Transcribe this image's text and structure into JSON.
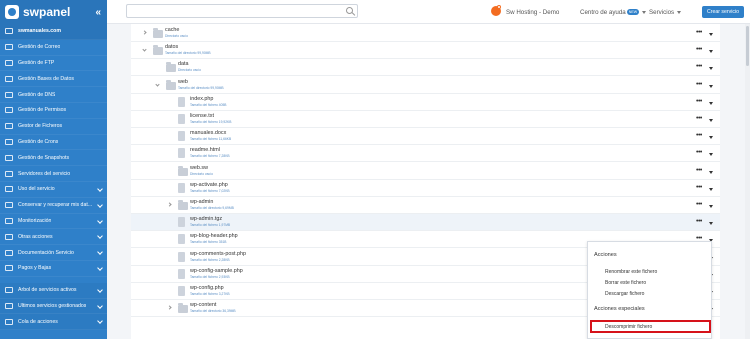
{
  "app": {
    "logo_text": "swpanel",
    "collapse_icon": "double-chevron-left-icon"
  },
  "header": {
    "search": {
      "value": "",
      "placeholder": ""
    },
    "account_name": "Sw Hosting - Demo",
    "help_label": "Centro de ayuda",
    "help_badge": "NEW",
    "services_label": "Servicios",
    "create_button": "Crear servicio",
    "accent": "#2f80c9",
    "avatar_color": "#f36c21"
  },
  "sidebar": {
    "account": "swmanuales.com",
    "items": [
      {
        "label": "Gestión de Correo",
        "icon": "mail-icon",
        "chevron": false
      },
      {
        "label": "Gestión de FTP",
        "icon": "server-icon",
        "chevron": false
      },
      {
        "label": "Gestión Bases de Datos",
        "icon": "database-icon",
        "chevron": false
      },
      {
        "label": "Gestión de DNS",
        "icon": "flag-icon",
        "chevron": false
      },
      {
        "label": "Gestión de Permisos",
        "icon": "permissions-icon",
        "chevron": false
      },
      {
        "label": "Gestor de Ficheros",
        "icon": "files-icon",
        "chevron": false
      },
      {
        "label": "Gestión de Crons",
        "icon": "clock-icon",
        "chevron": false
      },
      {
        "label": "Gestión de Snapshots",
        "icon": "snapshot-icon",
        "chevron": false
      },
      {
        "label": "Servidores del servicio",
        "icon": "servers-icon",
        "chevron": false
      },
      {
        "label": "Uso del servicio",
        "icon": "chart-icon",
        "chevron": true
      },
      {
        "label": "Conservar y recuperar mis dat...",
        "icon": "backup-icon",
        "chevron": true
      },
      {
        "label": "Monitorización",
        "icon": "monitor-icon",
        "chevron": true
      },
      {
        "label": "Otras acciones",
        "icon": "actions-icon",
        "chevron": true
      },
      {
        "label": "Documentación Servicio",
        "icon": "document-icon",
        "chevron": true
      },
      {
        "label": "Pagos y Bajas",
        "icon": "payment-icon",
        "chevron": true
      }
    ],
    "bottom_items": [
      {
        "label": "Árbol de servicios activos",
        "icon": "tree-icon",
        "chevron": true
      },
      {
        "label": "Últimos servicios gestionados",
        "icon": "history-icon",
        "chevron": true
      },
      {
        "label": "Cola de acciones",
        "icon": "queue-icon",
        "chevron": true
      }
    ]
  },
  "files": [
    {
      "name": "cache",
      "meta": "Directorio vacío",
      "type": "folder",
      "expander": "closed",
      "level": 0
    },
    {
      "name": "datos",
      "meta": "Tamaño del directorio 99,90MB",
      "type": "folder",
      "expander": "open",
      "level": 0
    },
    {
      "name": "data",
      "meta": "Directorio vacío",
      "type": "folder",
      "expander": "none",
      "level": 1
    },
    {
      "name": "web",
      "meta": "Tamaño del directorio 99,90MB",
      "type": "folder",
      "expander": "open",
      "level": 1
    },
    {
      "name": "index.php",
      "meta": "Tamaño del fichero 405B",
      "type": "file",
      "expander": "none",
      "level": 2
    },
    {
      "name": "license.txt",
      "meta": "Tamaño del fichero 19,92KB",
      "type": "file",
      "expander": "none",
      "level": 2
    },
    {
      "name": "manuales.docx",
      "meta": "Tamaño del fichero 11,66KB",
      "type": "file",
      "expander": "none",
      "level": 2
    },
    {
      "name": "readme.html",
      "meta": "Tamaño del fichero 7,28KB",
      "type": "file",
      "expander": "none",
      "level": 2
    },
    {
      "name": "web.sw",
      "meta": "Directorio vacío",
      "type": "folder",
      "expander": "none",
      "level": 2
    },
    {
      "name": "wp-activate.php",
      "meta": "Tamaño del fichero 7,02KB",
      "type": "file",
      "expander": "none",
      "level": 2
    },
    {
      "name": "wp-admin",
      "meta": "Tamaño del directorio 9,69MB",
      "type": "folder",
      "expander": "closed",
      "level": 2
    },
    {
      "name": "wp-admin.tgz",
      "meta": "Tamaño del fichero 1,97MB",
      "type": "file",
      "expander": "none",
      "level": 2,
      "highlighted": true
    },
    {
      "name": "wp-blog-header.php",
      "meta": "Tamaño del fichero 351B",
      "type": "file",
      "expander": "none",
      "level": 2
    },
    {
      "name": "wp-comments-post.php",
      "meta": "Tamaño del fichero 2,28KB",
      "type": "file",
      "expander": "none",
      "level": 2
    },
    {
      "name": "wp-config-sample.php",
      "meta": "Tamaño del fichero 2,93KB",
      "type": "file",
      "expander": "none",
      "level": 2
    },
    {
      "name": "wp-config.php",
      "meta": "Tamaño del fichero 3,27KB",
      "type": "file",
      "expander": "none",
      "level": 2
    },
    {
      "name": "wp-content",
      "meta": "Tamaño del directorio 36,39MB",
      "type": "folder",
      "expander": "closed",
      "level": 2
    }
  ],
  "menu": {
    "heading": "Acciones",
    "items": [
      "Renombrar este fichero",
      "Borrar este fichero",
      "Descargar fichero"
    ],
    "special_heading": "Acciones especiales",
    "highlighted_item": "Descomprimir fichero",
    "highlight_color": "#d6121a"
  }
}
